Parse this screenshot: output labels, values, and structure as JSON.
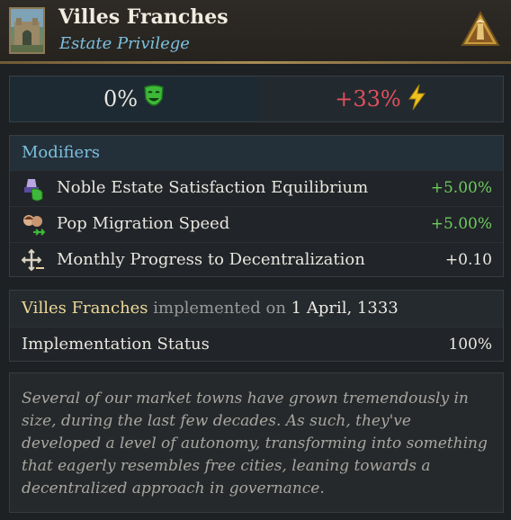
{
  "header": {
    "title": "Villes Franches",
    "subtitle": "Estate Privilege",
    "portrait_icon": "town-gate-portrait",
    "estate_icon": "nobility-estate-icon"
  },
  "stats": {
    "satisfaction": "0%",
    "satisfaction_icon": "happy-mask-icon",
    "power": "+33%",
    "power_icon": "lightning-icon"
  },
  "modifiers": {
    "heading": "Modifiers",
    "items": [
      {
        "icon": "noble-satisfaction-icon",
        "label": "Noble Estate Satisfaction Equilibrium",
        "value": "+5.00%",
        "color": "#6dcc5e"
      },
      {
        "icon": "pop-migration-icon",
        "label": "Pop Migration Speed",
        "value": "+5.00%",
        "color": "#6dcc5e"
      },
      {
        "icon": "decentralization-icon",
        "label": "Monthly Progress to Decentralization",
        "value": "+0.10",
        "color": "#ece9e2"
      }
    ]
  },
  "implementation": {
    "name": "Villes Franches",
    "implemented_on": "implemented on",
    "date": "1 April, 1333",
    "status_label": "Implementation Status",
    "status_value": "100%"
  },
  "description": "Several of our market towns have grown tremendously in size, during the last few decades. As such, they've developed a level of autonomy, transforming into something that eagerly resembles free cities, leaning towards a decentralized approach in governance.",
  "colors": {
    "accent_blue": "#7cc0e0",
    "positive": "#6dcc5e",
    "negative": "#e0505a",
    "gold": "#eed998"
  }
}
